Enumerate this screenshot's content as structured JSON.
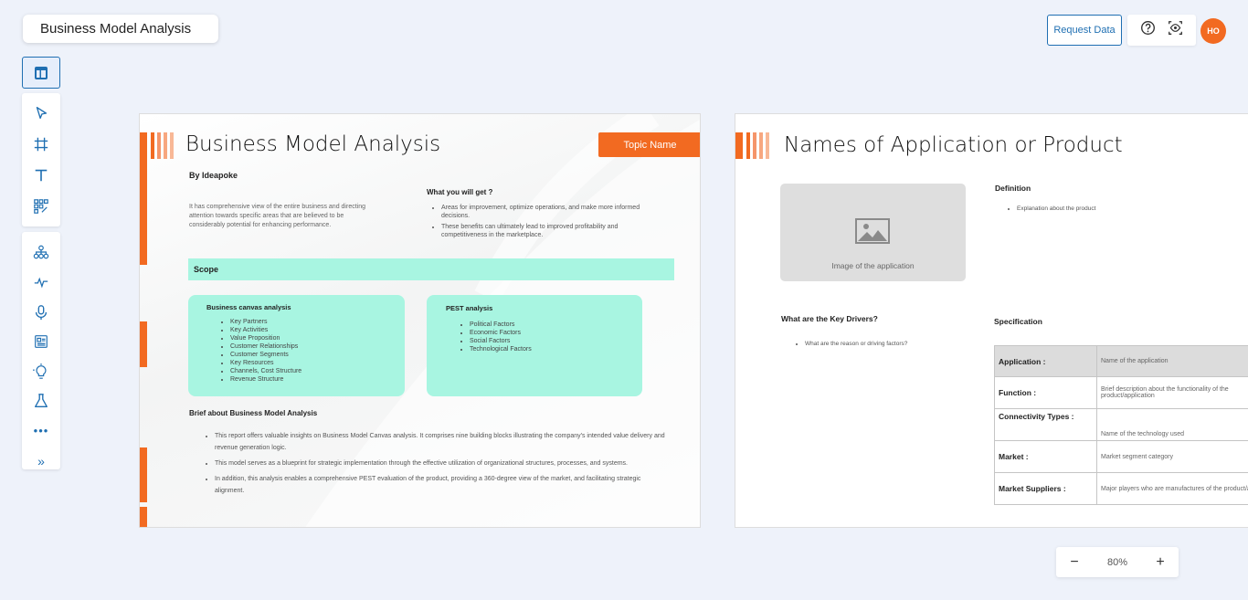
{
  "doc_title": "Business Model Analysis",
  "header": {
    "request_data": "Request Data",
    "icons": [
      "help-icon",
      "preview-icon"
    ],
    "avatar": "HO"
  },
  "toolbar": {
    "top": "layout-icon",
    "group1": [
      "select-icon",
      "frame-icon",
      "text-icon",
      "components-icon"
    ],
    "group2": [
      "hierarchy-icon",
      "activity-icon",
      "microphone-icon",
      "report-icon",
      "lightbulb-icon",
      "lab-flask-icon"
    ],
    "more": "•••",
    "expand": "»"
  },
  "slide1": {
    "title": "Business Model Analysis",
    "topic": "Topic Name",
    "by": "By Ideapoke",
    "intro": "It has comprehensive view of the entire business and directing attention towards specific areas that are believed to be considerably potential for enhancing performance.",
    "what_title": "What you will get ?",
    "what_items": [
      "Areas for improvement, optimize operations, and make more informed decisions.",
      "These benefits can ultimately lead to improved profitability and competitiveness in the marketplace."
    ],
    "scope": "Scope",
    "canvas_title": "Business canvas analysis",
    "canvas_items": [
      "Key Partners",
      "Key Activities",
      "Value Proposition",
      "Customer Relationships",
      "Customer Segments",
      "Key Resources",
      "Channels, Cost Structure",
      "Revenue Structure"
    ],
    "pest_title": "PEST analysis",
    "pest_items": [
      "Political Factors",
      "Economic Factors",
      "Social Factors",
      "Technological Factors"
    ],
    "brief_title": "Brief about Business Model Analysis",
    "brief_items": [
      "This report offers valuable insights on Business Model Canvas analysis. It comprises nine building blocks illustrating the company's intended value delivery and revenue generation logic.",
      "This model serves as a blueprint for strategic implementation through the effective utilization of organizational structures, processes, and systems.",
      "In addition, this analysis enables a comprehensive PEST evaluation of the product, providing a 360-degree view of the market, and facilitating strategic alignment."
    ]
  },
  "slide2": {
    "title": "Names of Application or Product",
    "image_caption": "Image of the application",
    "definition_title": "Definition",
    "definition_items": [
      "Explanation about the product"
    ],
    "key_drivers_title": "What are the Key Drivers?",
    "key_drivers_items": [
      "What are the reason or driving factors?"
    ],
    "spec_title": "Specification",
    "spec_rows": [
      {
        "k": "Application :",
        "v": "Name of the application"
      },
      {
        "k": "Function :",
        "v": "Brief description about the functionality of the product/application"
      },
      {
        "k": "Connectivity Types :",
        "v": "Name of the technology used"
      },
      {
        "k": "Market :",
        "v": "Market segment category"
      },
      {
        "k": "Market Suppliers :",
        "v": "Major players who are manufactures of the product/application"
      }
    ]
  },
  "zoom": {
    "minus": "−",
    "value": "80%",
    "plus": "+"
  },
  "colors": {
    "accent": "#f26a21",
    "mint": "#a8f5e1",
    "blue": "#1f6fb2"
  }
}
